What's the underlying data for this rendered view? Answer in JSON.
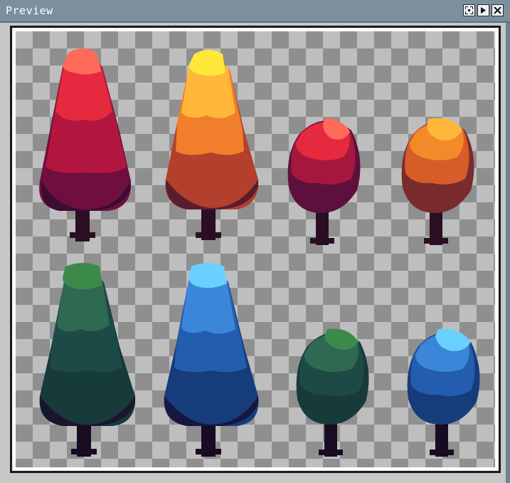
{
  "window": {
    "title": "Preview",
    "buttons": [
      {
        "name": "fit-view-icon"
      },
      {
        "name": "play-icon"
      },
      {
        "name": "close-icon"
      }
    ]
  },
  "sprites": [
    {
      "name": "tree-red-tall",
      "colors": [
        "#ff6a5a",
        "#e5293f",
        "#b2163e",
        "#6e0f3d",
        "#2a0f22"
      ]
    },
    {
      "name": "tree-yellow-orange-tall",
      "colors": [
        "#ffe83a",
        "#ffb63a",
        "#f07e2a",
        "#b3402c",
        "#2a0f22"
      ]
    },
    {
      "name": "tree-red-round",
      "colors": [
        "#ff6a5a",
        "#e5293f",
        "#a5173f",
        "#5e103c",
        "#2a0f22"
      ]
    },
    {
      "name": "tree-orange-round",
      "colors": [
        "#ffb63a",
        "#f38a2a",
        "#d85c28",
        "#7a2b2d",
        "#2a0f22"
      ]
    },
    {
      "name": "tree-green-tall",
      "colors": [
        "#3c8a4a",
        "#2e6a52",
        "#1e4a46",
        "#173a3a",
        "#170c22"
      ]
    },
    {
      "name": "tree-blue-tall",
      "colors": [
        "#6ad0ff",
        "#3b86d8",
        "#245cae",
        "#163c7c",
        "#170c22"
      ]
    },
    {
      "name": "tree-green-round",
      "colors": [
        "#3c8a4a",
        "#2e6a52",
        "#1e4a46",
        "#173a3a",
        "#170c22"
      ]
    },
    {
      "name": "tree-blue-round",
      "colors": [
        "#6ad0ff",
        "#3b86d8",
        "#245cae",
        "#163c7c",
        "#170c22"
      ]
    }
  ]
}
